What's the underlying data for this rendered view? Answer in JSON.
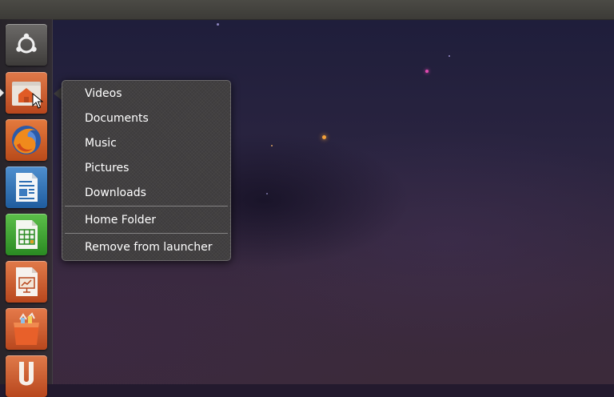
{
  "colors": {
    "panel": "#3c3b37",
    "menu_background": "#3e3c3d",
    "menu_text": "#ffffff",
    "accent_orange": "#e05b25"
  },
  "launcher": {
    "items": [
      {
        "name": "dash-home",
        "icon": "ubuntu-logo-icon",
        "running": false
      },
      {
        "name": "home-folder",
        "icon": "home-folder-icon",
        "running": true
      },
      {
        "name": "firefox",
        "icon": "firefox-icon",
        "running": false
      },
      {
        "name": "libreoffice-writer",
        "icon": "writer-document-icon",
        "running": false
      },
      {
        "name": "libreoffice-calc",
        "icon": "calc-spreadsheet-icon",
        "running": false
      },
      {
        "name": "libreoffice-impress",
        "icon": "impress-presentation-icon",
        "running": false
      },
      {
        "name": "ubuntu-software-center",
        "icon": "shopping-bag-icon",
        "running": false
      },
      {
        "name": "ubuntu-one",
        "icon": "ubuntu-one-icon",
        "running": false
      }
    ]
  },
  "quicklist": {
    "items": [
      {
        "label": "Videos"
      },
      {
        "label": "Documents"
      },
      {
        "label": "Music"
      },
      {
        "label": "Pictures"
      },
      {
        "label": "Downloads"
      }
    ],
    "home_folder_label": "Home Folder",
    "remove_label": "Remove from launcher"
  }
}
